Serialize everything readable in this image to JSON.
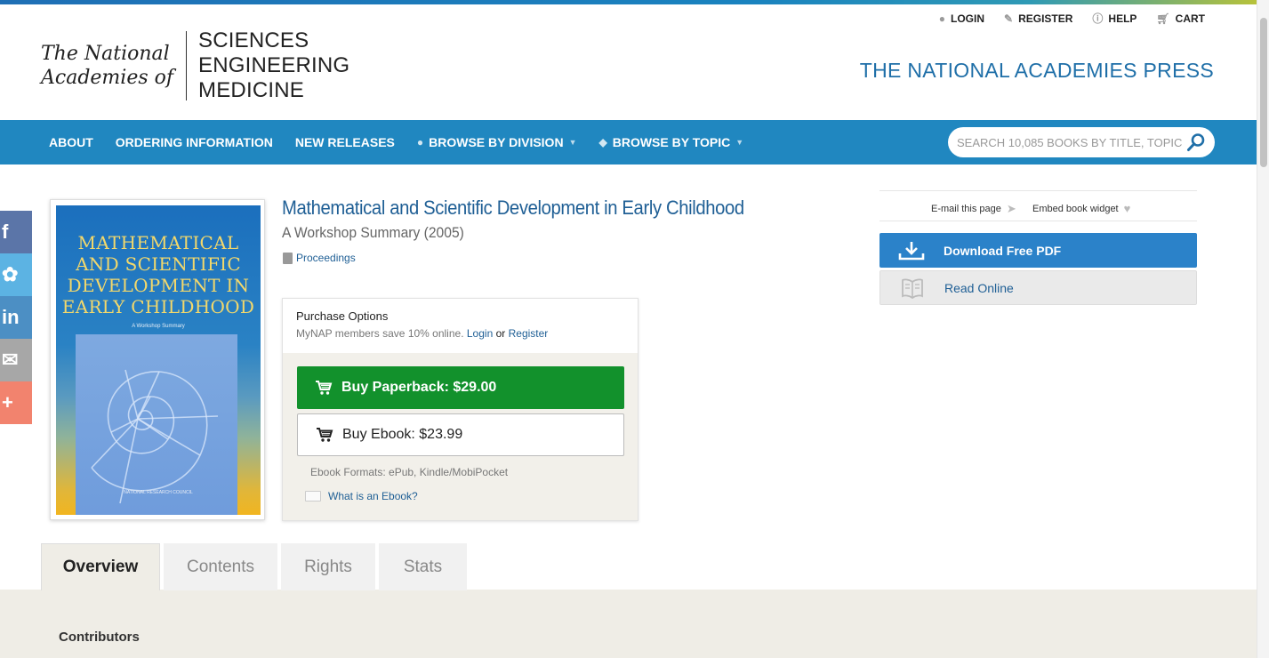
{
  "header": {
    "logo": {
      "left": "The National Academies of",
      "left_line1": "The National",
      "left_line2": "Academies of",
      "right_line1": "SCIENCES",
      "right_line2": "ENGINEERING",
      "right_line3": "MEDICINE"
    },
    "press_title": "THE NATIONAL ACADEMIES PRESS",
    "util_nav": [
      {
        "label": "LOGIN",
        "icon": "user-icon"
      },
      {
        "label": "REGISTER",
        "icon": "pencil-icon"
      },
      {
        "label": "HELP",
        "icon": "question-icon"
      },
      {
        "label": "CART",
        "icon": "cart-icon"
      }
    ]
  },
  "nav": {
    "items": [
      "ABOUT",
      "ORDERING INFORMATION",
      "NEW RELEASES",
      "BROWSE BY DIVISION",
      "BROWSE BY TOPIC"
    ],
    "search_placeholder": "SEARCH 10,085 BOOKS BY TITLE, TOPIC"
  },
  "social": [
    "facebook",
    "twitter",
    "linkedin",
    "email",
    "more"
  ],
  "cover": {
    "title_line1": "MATHEMATICAL",
    "title_line2": "AND SCIENTIFIC",
    "title_line3": "DEVELOPMENT IN",
    "title_line4": "EARLY CHILDHOOD",
    "subtitle": "A Workshop Summary",
    "publisher": "NATIONAL RESEARCH COUNCIL"
  },
  "book": {
    "title": "Mathematical and Scientific Development in Early Childhood",
    "subtitle": "A Workshop Summary (2005)",
    "type": "Proceedings"
  },
  "purchase": {
    "title": "Purchase Options",
    "note": "MyNAP members save 10% online.",
    "login": "Login",
    "or": "or",
    "register": "Register",
    "paperback": "Buy Paperback: $29.00",
    "ebook": "Buy Ebook: $23.99",
    "formats": "Ebook Formats: ePub, Kindle/MobiPocket",
    "what_ebook": "What is an Ebook?"
  },
  "sidebar": {
    "email": "E-mail this page",
    "embed": "Embed book widget",
    "download": "Download Free PDF",
    "read": "Read Online"
  },
  "tabs": [
    "Overview",
    "Contents",
    "Rights",
    "Stats"
  ],
  "content": {
    "heading": "Contributors"
  },
  "colors": {
    "nav_blue": "#2087c0",
    "title_blue": "#1f5f95",
    "buy_green": "#12912c",
    "pdf_blue": "#2b82c9"
  }
}
